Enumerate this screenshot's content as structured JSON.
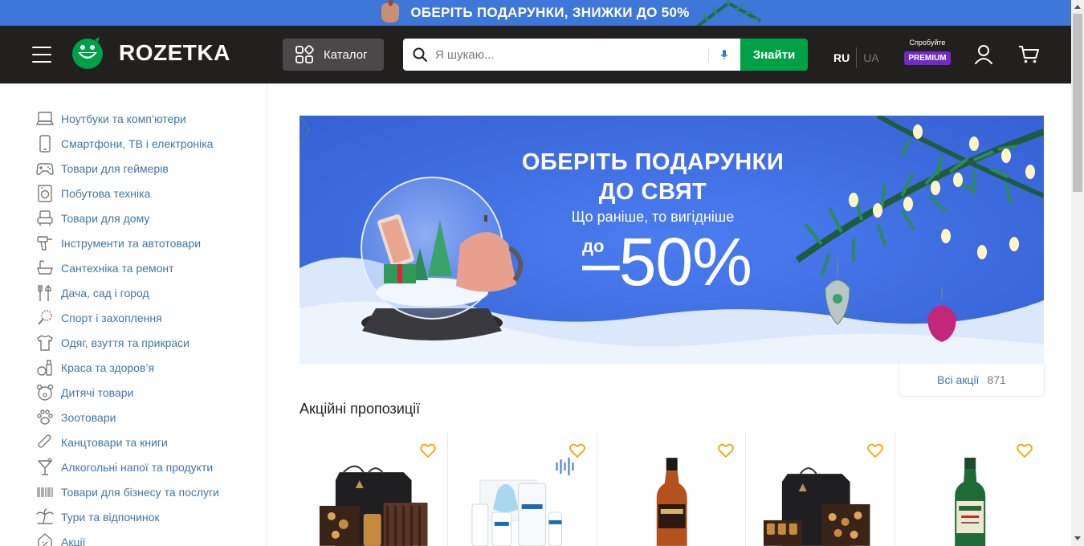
{
  "promo_strip": {
    "text": "ОБЕРІТЬ ПОДАРУНКИ, ЗНИЖКИ  ДО 50%"
  },
  "header": {
    "logo_text": "ROZETKA",
    "catalog_label": "Каталог",
    "search": {
      "placeholder": "Я шукаю...",
      "value": ""
    },
    "search_button": "Знайти",
    "languages": {
      "ru": "RU",
      "ua": "UA"
    },
    "premium": {
      "try_label": "Спробуйте",
      "badge": "PREMIUM"
    }
  },
  "sidebar": {
    "items": [
      {
        "label": "Ноутбуки та комп’ютери",
        "icon": "laptop-icon"
      },
      {
        "label": "Смартфони, ТВ і електроніка",
        "icon": "smartphone-icon"
      },
      {
        "label": "Товари для геймерів",
        "icon": "gamepad-icon"
      },
      {
        "label": "Побутова техніка",
        "icon": "washing-machine-icon"
      },
      {
        "label": "Товари для дому",
        "icon": "armchair-icon"
      },
      {
        "label": "Інструменти та автотовари",
        "icon": "drill-icon"
      },
      {
        "label": "Сантехніка та ремонт",
        "icon": "bathtub-icon"
      },
      {
        "label": "Дача, сад і город",
        "icon": "garden-tools-icon"
      },
      {
        "label": "Спорт і захоплення",
        "icon": "racket-icon"
      },
      {
        "label": "Одяг, взуття та прикраси",
        "icon": "tshirt-icon"
      },
      {
        "label": "Краса та здоров’я",
        "icon": "cosmetics-icon"
      },
      {
        "label": "Дитячі товари",
        "icon": "teddy-bear-icon"
      },
      {
        "label": "Зоотовари",
        "icon": "paw-icon"
      },
      {
        "label": "Канцтовари та книги",
        "icon": "paperclip-icon"
      },
      {
        "label": "Алкогольні напої та продукти",
        "icon": "cocktail-icon"
      },
      {
        "label": "Товари для бізнесу та послуги",
        "icon": "barcode-icon"
      },
      {
        "label": "Тури та відпочинок",
        "icon": "palm-tree-icon"
      },
      {
        "label": "Акції",
        "icon": "percent-tag-icon"
      }
    ]
  },
  "banner": {
    "title_line1": "ОБЕРІТЬ ПОДАРУНКИ",
    "title_line2": "ДО СВЯТ",
    "subtitle": "Що раніше, то вигідніше",
    "discount_prefix": "до",
    "discount": "–50%"
  },
  "all_promos": {
    "label": "Всі акції",
    "count": "871"
  },
  "section_title": "Акційні пропозиції",
  "products": [
    {
      "name": "gift-box-chocolates",
      "heart": "heart-icon"
    },
    {
      "name": "la-roche-posay-set",
      "heart": "heart-icon"
    },
    {
      "name": "oakheart-rum-bottle",
      "heart": "heart-icon"
    },
    {
      "name": "gift-box-sweets",
      "heart": "heart-icon"
    },
    {
      "name": "jameson-whiskey-bottle",
      "heart": "heart-icon"
    }
  ],
  "colors": {
    "promo_blue": "#3e77d8",
    "header_dark": "#221f1f",
    "accent_green": "#00a046",
    "link_blue": "#3e77aa",
    "premium_purple": "#6f2bc4",
    "heart_orange": "#f8a200"
  }
}
